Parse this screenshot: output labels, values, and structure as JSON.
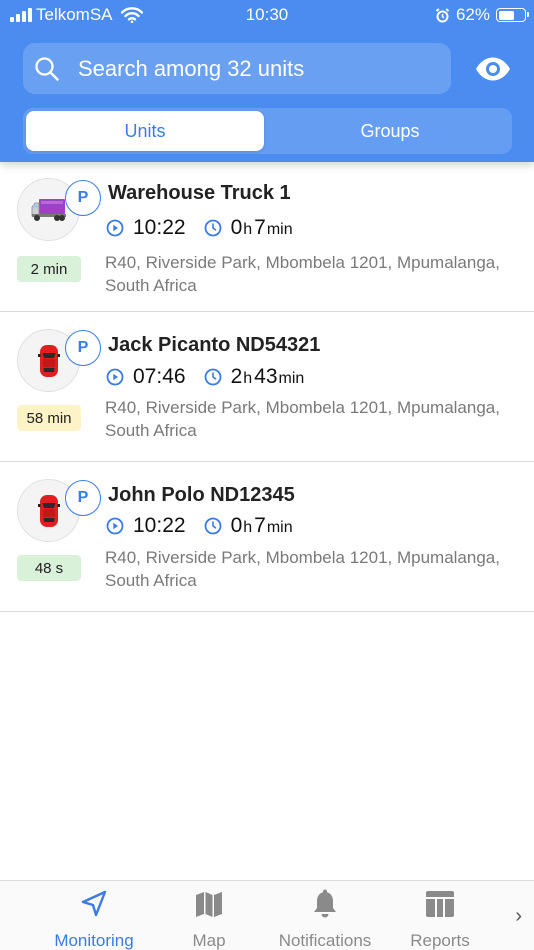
{
  "status_bar": {
    "carrier": "TelkomSA",
    "time": "10:30",
    "battery": "62%",
    "battery_level": 0.62
  },
  "search": {
    "placeholder": "Search among 32 units",
    "icon": "search-icon"
  },
  "view_toggle_icon": "eye-icon",
  "segments": {
    "active": "Units",
    "inactive": "Groups"
  },
  "units": [
    {
      "name": "Warehouse Truck 1",
      "icon": "truck-icon",
      "parking_badge": "P",
      "age": "2 min",
      "age_color": "#d9f0d9",
      "start_time": "10:22",
      "duration_h": "0",
      "duration_h_unit": "h",
      "duration_m": "7",
      "duration_m_unit": "min",
      "address": "R40, Riverside Park, Mbombela 1201, Mpumalanga, South Africa"
    },
    {
      "name": "Jack Picanto ND54321",
      "icon": "car-icon",
      "parking_badge": "P",
      "age": "58 min",
      "age_color": "#fdf3c6",
      "start_time": "07:46",
      "duration_h": "2",
      "duration_h_unit": "h",
      "duration_m": "43",
      "duration_m_unit": "min",
      "address": "R40, Riverside Park, Mbombela 1201, Mpumalanga, South Africa"
    },
    {
      "name": "John Polo ND12345",
      "icon": "car-icon",
      "parking_badge": "P",
      "age": "48 s",
      "age_color": "#d9f0d9",
      "start_time": "10:22",
      "duration_h": "0",
      "duration_h_unit": "h",
      "duration_m": "7",
      "duration_m_unit": "min",
      "address": "R40, Riverside Park, Mbombela 1201, Mpumalanga, South Africa"
    }
  ],
  "tabs": [
    {
      "label": "Monitoring",
      "icon": "navigation-arrow-icon",
      "active": true
    },
    {
      "label": "Map",
      "icon": "map-icon",
      "active": false
    },
    {
      "label": "Notifications",
      "icon": "bell-icon",
      "active": false
    },
    {
      "label": "Reports",
      "icon": "reports-icon",
      "active": false
    }
  ],
  "more_tabs_icon": "chevron-right-icon",
  "colors": {
    "header": "#4a8cf0",
    "accent": "#3b7be6",
    "badge_green": "#d9f0d9",
    "badge_yellow": "#fdf3c6"
  }
}
